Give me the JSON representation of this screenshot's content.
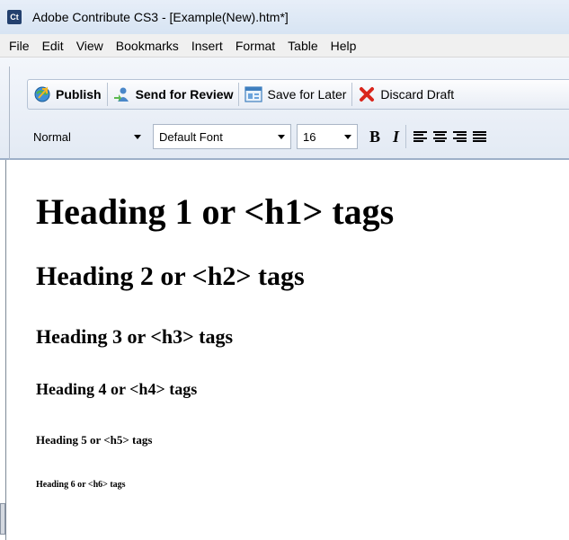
{
  "window": {
    "app_icon_text": "Ct",
    "title": "Adobe Contribute CS3 - [Example(New).htm*]"
  },
  "menu": [
    "File",
    "Edit",
    "View",
    "Bookmarks",
    "Insert",
    "Format",
    "Table",
    "Help"
  ],
  "toolbar": {
    "publish_label": "Publish",
    "send_review_label": "Send for Review",
    "save_later_label": "Save for Later",
    "discard_draft_label": "Discard Draft"
  },
  "format_bar": {
    "style_value": "Normal",
    "font_value": "Default Font",
    "size_value": "16",
    "bold_label": "B",
    "italic_label": "I"
  },
  "document": {
    "h1": "Heading 1 or <h1> tags",
    "h2": "Heading 2 or <h2> tags",
    "h3": "Heading 3 or <h3> tags",
    "h4": "Heading 4 or <h4> tags",
    "h5": "Heading 5 or <h5> tags",
    "h6": "Heading 6 or <h6> tags"
  },
  "icons": [
    "publish-icon",
    "send-review-icon",
    "save-later-icon",
    "discard-icon",
    "align-left-icon",
    "align-center-icon",
    "align-right-icon",
    "justify-icon"
  ],
  "colors": {
    "app_icon_bg": "#23406e",
    "discard_x": "#d9261c"
  }
}
